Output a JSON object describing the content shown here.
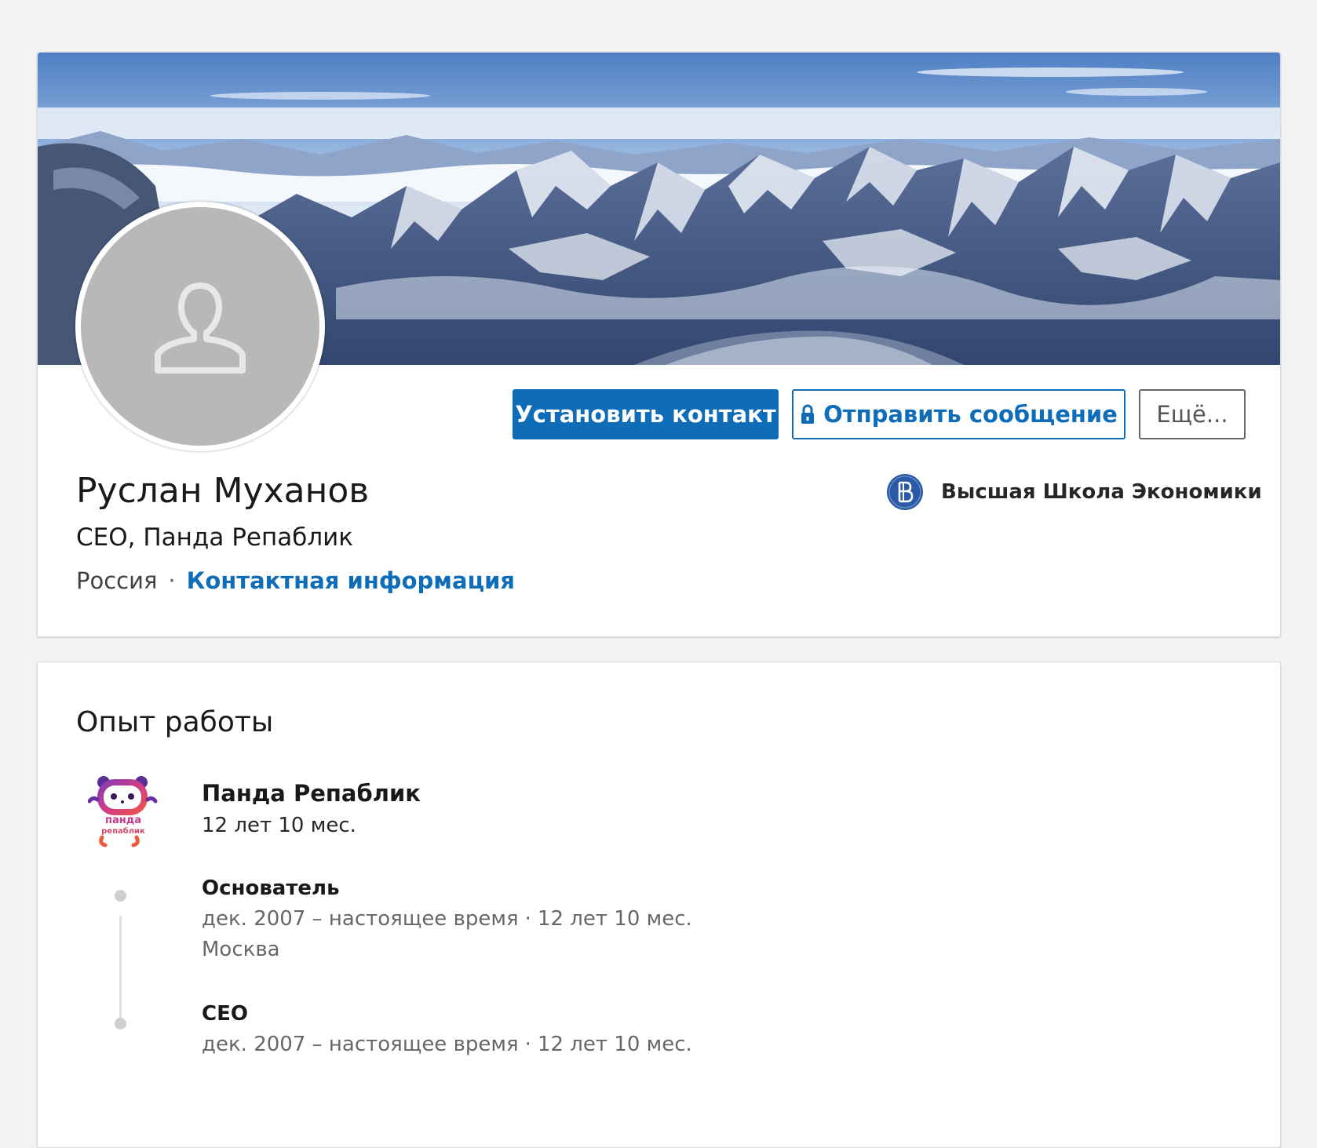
{
  "profile": {
    "name": "Руслан Муханов",
    "headline": "CEO, Панда Репаблик",
    "location": "Россия",
    "separator": "·",
    "contact_info_label": "Контактная информация",
    "school": "Высшая Школа Экономики"
  },
  "actions": {
    "connect_label": "Установить контакт",
    "message_label": "Отправить сообщение",
    "more_label": "Ещё..."
  },
  "experience": {
    "title": "Опыт работы",
    "company": "Панда Репаблик",
    "company_logo_text": [
      "панда",
      "репаблик"
    ],
    "total_duration": "12 лет 10 мес.",
    "roles": [
      {
        "title": "Основатель",
        "dates": "дек. 2007 – настоящее время",
        "duration": "12 лет 10 мес.",
        "location": "Москва"
      },
      {
        "title": "CEO",
        "dates": "дек. 2007 – настоящее время",
        "duration": "12 лет 10 мес.",
        "location": ""
      }
    ]
  },
  "colors": {
    "accent": "#0f6db8",
    "page_background": "#f3f3f3",
    "avatar_placeholder": "#b8b8b8",
    "school_logo": "#2a5aa8"
  },
  "icons": {
    "avatar_placeholder": "person-silhouette-icon",
    "message_lock": "lock-icon",
    "school_logo": "hse-logo",
    "company_logo": "panda-republic-logo"
  }
}
